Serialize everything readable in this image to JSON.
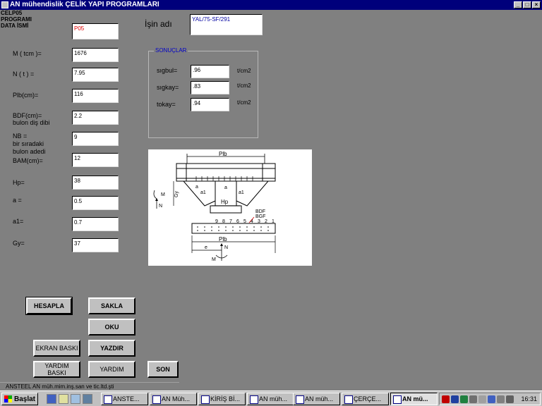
{
  "window": {
    "title": "AN mühendislik  ÇELİK YAPI PROGRAMLARI",
    "buttons": {
      "minimize": "_",
      "maximize": "□",
      "close": "×"
    }
  },
  "header": {
    "program_line1": "CELP05",
    "program_line2": "PROGRAMI",
    "program_line3": "DATA  İSMİ",
    "data_name_value": "P05",
    "job_label": "İşin adı",
    "job_value": "YAL/75-SF/291"
  },
  "inputs": [
    {
      "label": "M ( tcm )=",
      "value": "1676"
    },
    {
      "label": "N ( t )  =",
      "value": "7.95"
    },
    {
      "label": "Plb(cm)=",
      "value": "116"
    },
    {
      "label": "BDF(cm)=",
      "label2": "bulon diş dibi",
      "value": "2.2"
    },
    {
      "label": "NB =",
      "label2": "bir sıradaki",
      "label3": "bulon adedi",
      "value": "9"
    },
    {
      "label": "BAM(cm)=",
      "value": "12"
    },
    {
      "label": "Hp=",
      "value": "38"
    },
    {
      "label": "a =",
      "value": "0.5"
    },
    {
      "label": "a1=",
      "value": "0.7"
    },
    {
      "label": "Gy=",
      "value": "37"
    }
  ],
  "results": {
    "title": "SONUÇLAR",
    "rows": [
      {
        "label": "sıgbul=",
        "value": ".96",
        "unit": "t/cm2"
      },
      {
        "label": "sıgkay=",
        "value": ".83",
        "unit": "t/cm2"
      },
      {
        "label": "tokay=",
        "value": ".94",
        "unit": "t/cm2"
      }
    ]
  },
  "diagram": {
    "plb_top": "Plb",
    "gy": "Gy",
    "m": "M",
    "n": "N",
    "a": "a",
    "a1": "a1",
    "hp": "Hp",
    "bdf": "BDF",
    "bgf": "BGF",
    "bolt_numbers": [
      "9",
      "8",
      "7",
      "6",
      "5",
      "4",
      "3",
      "2",
      "1"
    ],
    "plb_bottom": "Plb",
    "e": "e",
    "n_bottom": "N",
    "m_bottom": "M"
  },
  "buttons": {
    "hesapla": "HESAPLA",
    "sakla": "SAKLA",
    "oku": "OKU",
    "ekran_baski": "EKRAN BASKI",
    "yazdir": "YAZDIR",
    "yardim_baski": "YARDIM BASKI",
    "yardim": "YARDIM",
    "son": "SON"
  },
  "status": "ANSTEEL   AN müh.mim.inş.san ve tic.ltd.şti",
  "taskbar": {
    "start": "Başlat",
    "tasks": [
      "ANSTE...",
      "AN Müh...",
      "KİRİŞ Bİ...",
      "AN müh...",
      "AN müh...",
      "ÇERÇE...",
      "AN mü..."
    ],
    "clock": "16:31"
  },
  "colors": {
    "title_bg": "#00007b",
    "form_bg": "#808080",
    "accent_red": "#e00000",
    "accent_blue": "#0000c8"
  }
}
